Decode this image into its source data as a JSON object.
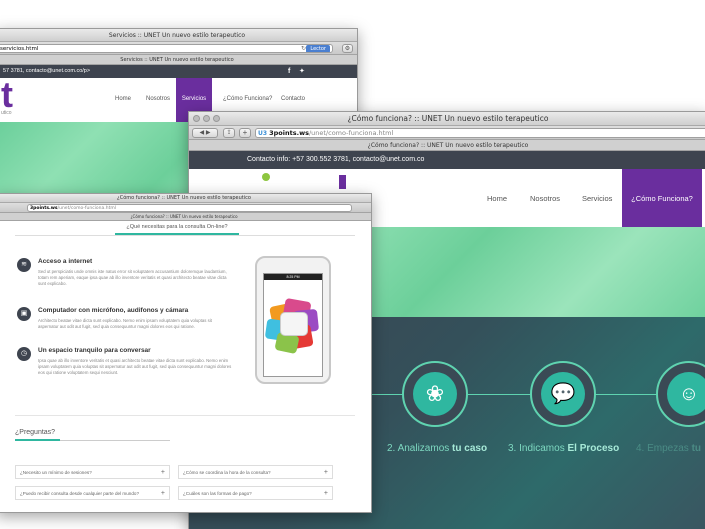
{
  "win1": {
    "title": "Servicios :: UNET Un nuevo estilo terapeutico",
    "url": "servicios.html",
    "reader": "Lector",
    "tab": "Servicios :: UNET Un nuevo estilo terapeutico",
    "contact": "57 3781, contacto@unet.com.co/p>",
    "logo_fragment": "t",
    "logo_sub": "utico",
    "nav": [
      "Home",
      "Nosotros",
      "Servicios",
      "¿Cómo Funciona?",
      "Contacto"
    ]
  },
  "win2": {
    "title": "¿Cómo funciona? :: UNET Un nuevo estilo terapeutico",
    "url_domain": "3points.ws",
    "url_path": "/unet/como-funciona.html",
    "tab": "¿Cómo funciona? :: UNET Un nuevo estilo terapeutico",
    "contact": "Contacto info: +57 300.552 3781, contacto@unet.com.co",
    "nav": [
      "Home",
      "Nosotros",
      "Servicios",
      "¿Cómo Funciona?"
    ],
    "steps": [
      {
        "prefix": "2. Analizamos ",
        "bold": "tu caso"
      },
      {
        "prefix": "3. Indicamos ",
        "bold": "El Proceso"
      },
      {
        "prefix": "4. Empezas ",
        "bold": "tu"
      }
    ]
  },
  "win3": {
    "title": "¿Cómo funciona? :: UNET Un nuevo estilo terapeutico",
    "url_domain": "3points.ws",
    "url_path": "/unet/como-funciona.html",
    "tab": "¿Cómo funciona? :: UNET Un nuevo estilo terapeutico",
    "section_tab": "¿Qué necesitas para la consulta On-line?",
    "items": [
      {
        "title": "Acceso a internet",
        "body": "Sed ut perspiciatis unde omnis iste natus error sit voluptatem accusantium doloremque laudantium, totam rem aperiam, eaque ipsa quae ab illo inventore veritatis et quasi architecto beatae vitae dicta sunt explicabo."
      },
      {
        "title": "Computador con micrófono, audifonos y cámara",
        "body": "Architecto beatae vitae dicta sunt explicabo. Nemo enim ipsam voluptatem quia voluptas sit aspernatur aut odit aut fugit, sed quia consequuntur magni dolores eos qui ratione."
      },
      {
        "title": "Un espacio tranquilo para conversar",
        "body": "Ipsa quae ab illo inventore veritatis et quasi architecto beatae vitae dicta sunt explicabo. Nemo enim ipsam voluptatem quia voluptas sit aspernatur aut odit aut fugit, sed quia consequuntur magni dolores eos qui ratione voluptatem sequi nesciunt."
      }
    ],
    "phone_time": "8:25 PM",
    "faq_title": "¿Preguntas?",
    "faqs": [
      "¿Necesito un mínimo de sesiones?",
      "¿Cómo se coordina la hora de la consulta?",
      "¿Puedo recibir consulta desde cualquier parte del mundo?",
      "¿Cuáles son las formas de pago?"
    ]
  },
  "colors": {
    "purple": "#6a2e9e",
    "green": "#7dd8a8",
    "teal": "#5fd3b0",
    "dark": "#3e444f"
  }
}
